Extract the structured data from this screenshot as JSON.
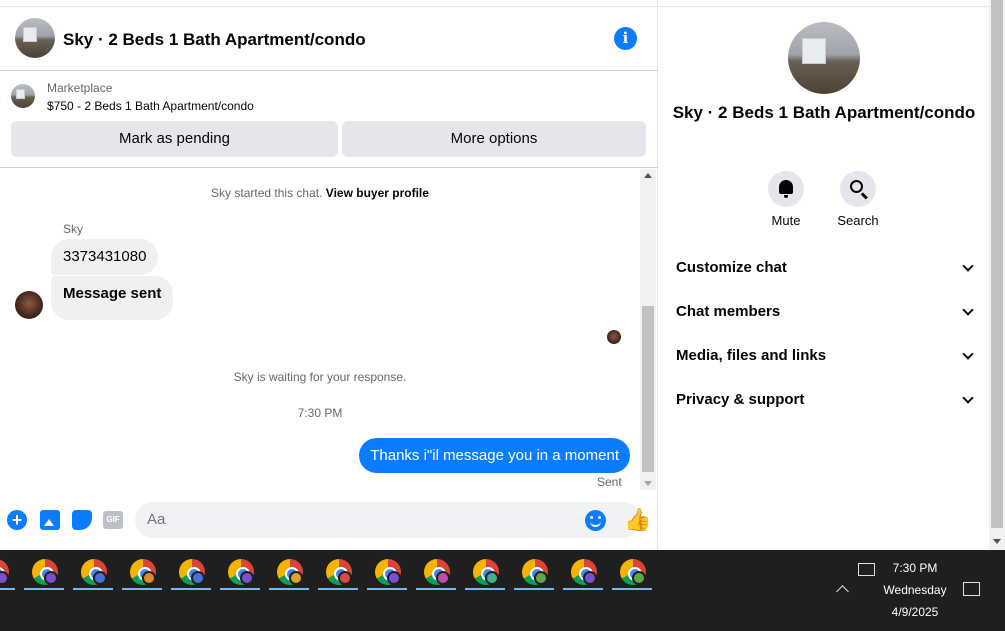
{
  "header": {
    "title": "Sky · 2 Beds 1 Bath Apartment/condo"
  },
  "marketplace": {
    "label": "Marketplace",
    "listing": "$750 - 2 Beds 1 Bath Apartment/condo",
    "mark_pending": "Mark as pending",
    "more_options": "More options"
  },
  "messages": {
    "started": "Sky started this chat.",
    "view_profile": "View buyer profile",
    "sender": "Sky",
    "msg1": "3373431080",
    "msg2": "Message sent",
    "waiting": "Sky is waiting for your response.",
    "time": "7:30 PM",
    "outgoing": "Thanks i\"il message you in a moment",
    "status": "Sent"
  },
  "composer": {
    "placeholder": "Aa",
    "gif": "GIF"
  },
  "details": {
    "title": "Sky · 2 Beds 1 Bath Apartment/condo",
    "mute": "Mute",
    "search": "Search",
    "sections": [
      "Customize chat",
      "Chat members",
      "Media, files and links",
      "Privacy & support"
    ]
  },
  "taskbar": {
    "time": "7:30 PM",
    "day": "Wednesday",
    "date": "4/9/2025",
    "profile_colors": [
      "#7a4fd1",
      "#7a4fd1",
      "#4a6fd8",
      "#e08a2c",
      "#4a6fd8",
      "#7a4fd1",
      "#e0a12c",
      "#d84a4a",
      "#7a4fd1",
      "#c44ab0",
      "#3fb28a",
      "#5aa84a",
      "#7a4fd1",
      "#5aa84a"
    ]
  }
}
